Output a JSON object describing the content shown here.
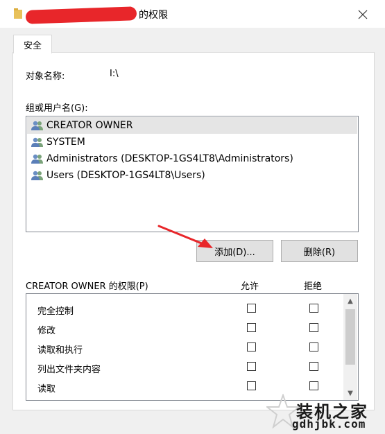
{
  "window": {
    "title": "的权限",
    "close_icon": "close-icon"
  },
  "tabs": [
    {
      "label": "安全",
      "selected": true
    }
  ],
  "object": {
    "label": "对象名称:",
    "value": "I:\\"
  },
  "groups": {
    "label": "组或用户名(G):",
    "items": [
      {
        "label": "CREATOR OWNER",
        "icon": "users-icon",
        "selected": true
      },
      {
        "label": "SYSTEM",
        "icon": "users-icon",
        "selected": false
      },
      {
        "label": "Administrators (DESKTOP-1GS4LT8\\Administrators)",
        "icon": "users-icon",
        "selected": false
      },
      {
        "label": "Users (DESKTOP-1GS4LT8\\Users)",
        "icon": "users-icon",
        "selected": false
      }
    ]
  },
  "buttons": {
    "add": "添加(D)...",
    "remove": "删除(R)"
  },
  "permissions": {
    "title": "CREATOR OWNER 的权限(P)",
    "allow_header": "允许",
    "deny_header": "拒绝",
    "rows": [
      {
        "name": "完全控制",
        "allow": false,
        "deny": false
      },
      {
        "name": "修改",
        "allow": false,
        "deny": false
      },
      {
        "name": "读取和执行",
        "allow": false,
        "deny": false
      },
      {
        "name": "列出文件夹内容",
        "allow": false,
        "deny": false
      },
      {
        "name": "读取",
        "allow": false,
        "deny": false
      }
    ]
  },
  "watermark": {
    "line1": "装机之家",
    "line2": "gdhjbk.com"
  },
  "colors": {
    "annotation_arrow": "#e8262a",
    "redaction": "#e8262a",
    "selection": "#e5e5e5"
  }
}
